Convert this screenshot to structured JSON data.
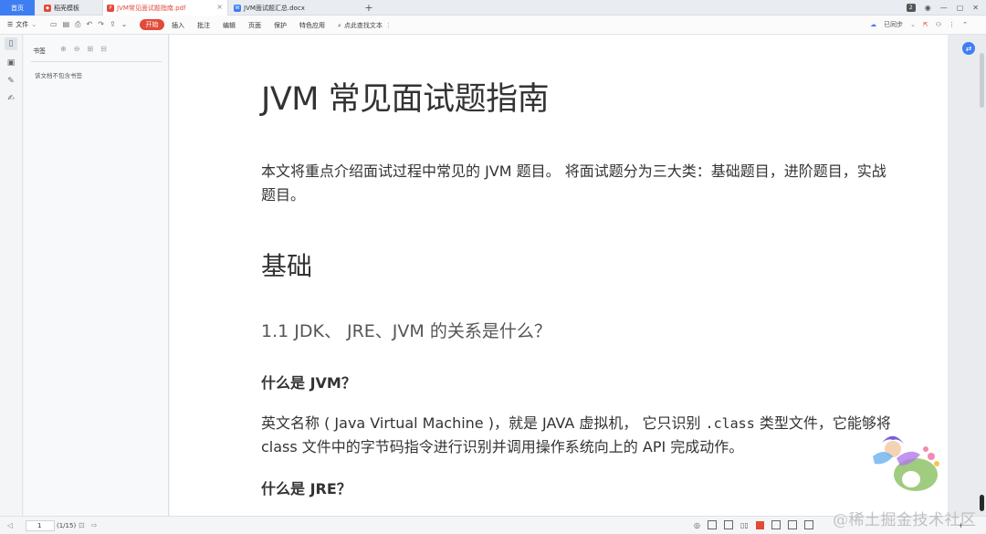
{
  "tabs": {
    "home": "首页",
    "template": "稻壳模板",
    "pdf": "JVM常见面试题指南.pdf",
    "docx": "JVM面试题汇总.docx",
    "add": "+",
    "badge": "2"
  },
  "toolbar": {
    "file": "文件",
    "start": "开始",
    "insert": "插入",
    "annotate": "批注",
    "edit": "编辑",
    "page": "页面",
    "protect": "保护",
    "features": "特色应用",
    "search": "点此查找文本",
    "sync": "已同步"
  },
  "panel": {
    "title": "书签",
    "empty": "该文档不包含书签"
  },
  "doc": {
    "h1": "JVM 常见面试题指南",
    "intro": "本文将重点介绍面试过程中常见的 JVM 题目。 将面试题分为三大类：基础题目，进阶题目，实战题目。",
    "h2": "基础",
    "h3": "1.1 JDK、 JRE、JVM 的关系是什么？",
    "h4a": "什么是 JVM？",
    "p1_before": "英文名称 ( Java Virtual Machine )，就是 JAVA 虚拟机， 它只识别 ",
    "p1_code": ".class",
    "p1_after": " 类型文件，它能够将 class 文件中的字节码指令进行识别并调用操作系统向上的 API 完成动作。",
    "h4b": "什么是 JRE？"
  },
  "status": {
    "page": "1",
    "count": "(1/15)",
    "zoom": "+"
  },
  "watermark": "@稀土掘金技术社区",
  "icons": [
    "bookmark-icon",
    "thumbnail-icon",
    "annotation-icon",
    "signature-icon",
    "search-icon",
    "sync-icon",
    "share-icon",
    "settings-icon"
  ]
}
